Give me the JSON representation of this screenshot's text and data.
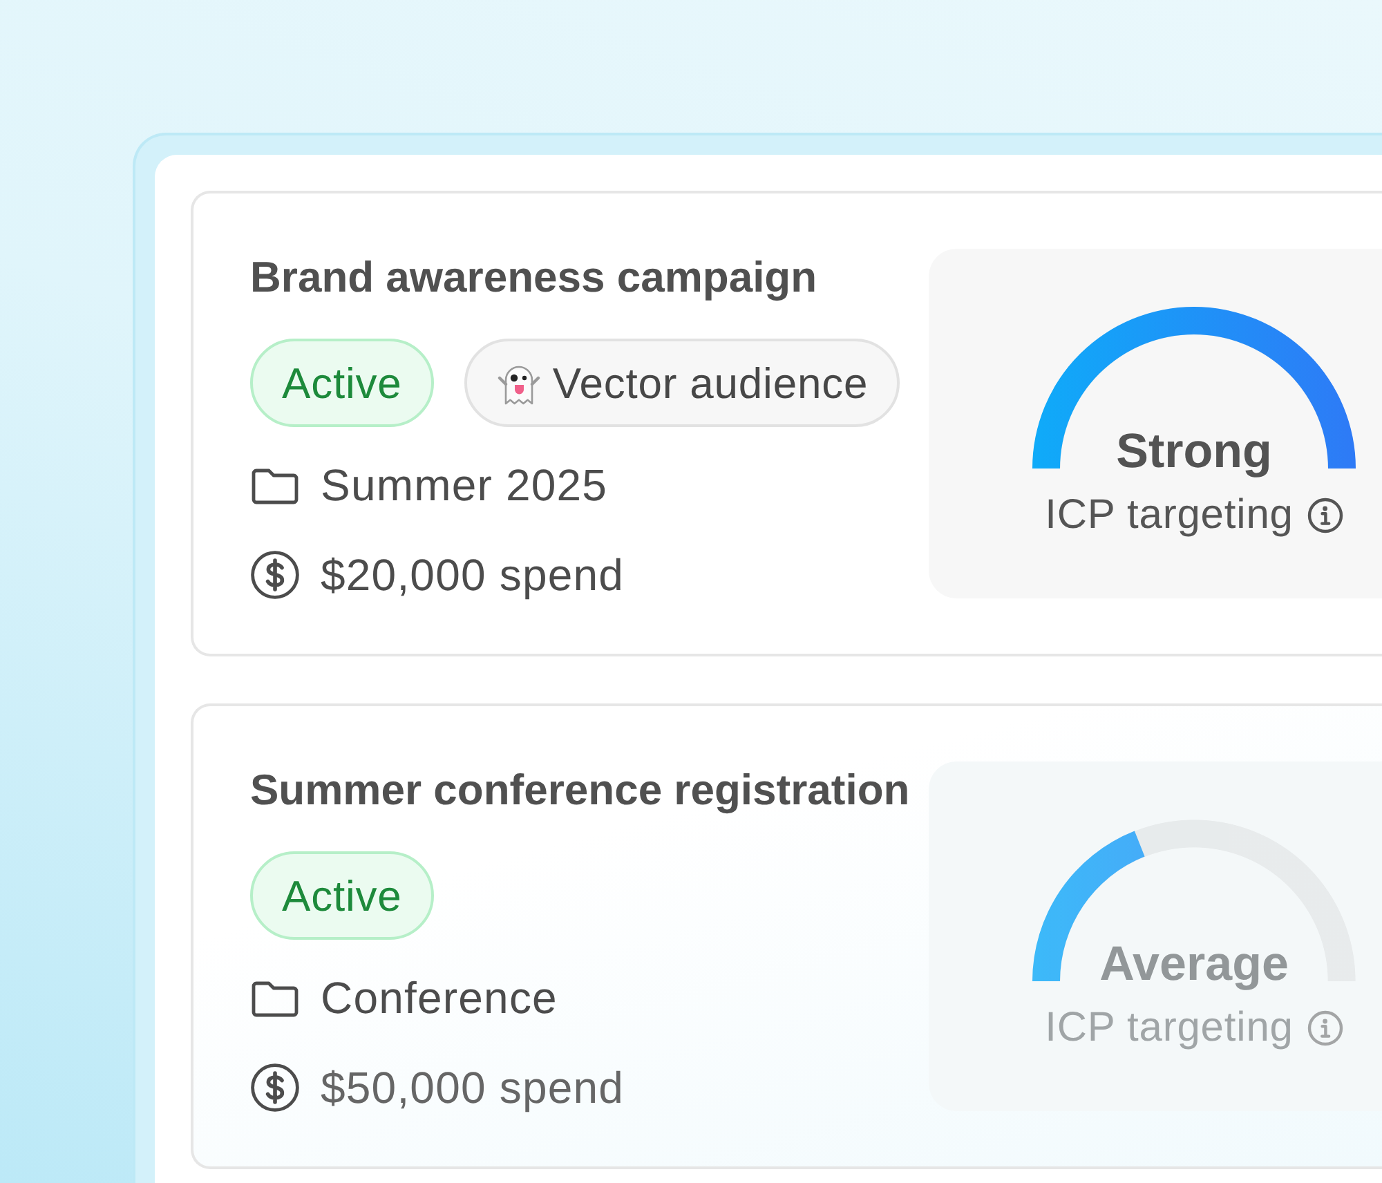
{
  "campaigns": [
    {
      "title": "Brand awareness campaign",
      "tags": [
        {
          "kind": "status",
          "label": "Active"
        },
        {
          "kind": "audience",
          "label": "Vector audience"
        }
      ],
      "details": [
        {
          "kind": "folder",
          "text": "Summer 2025"
        },
        {
          "kind": "spend",
          "text": "$20,000 spend"
        }
      ],
      "score": {
        "rating": "Strong",
        "level": 1,
        "caption": "ICP targeting"
      }
    },
    {
      "title": "Summer conference registration",
      "tags": [
        {
          "kind": "status",
          "label": "Active"
        }
      ],
      "details": [
        {
          "kind": "folder",
          "text": "Conference"
        },
        {
          "kind": "spend",
          "text": "$50,000 spend"
        }
      ],
      "score": {
        "rating": "Average",
        "level": 0.38,
        "caption": "ICP targeting"
      }
    }
  ]
}
